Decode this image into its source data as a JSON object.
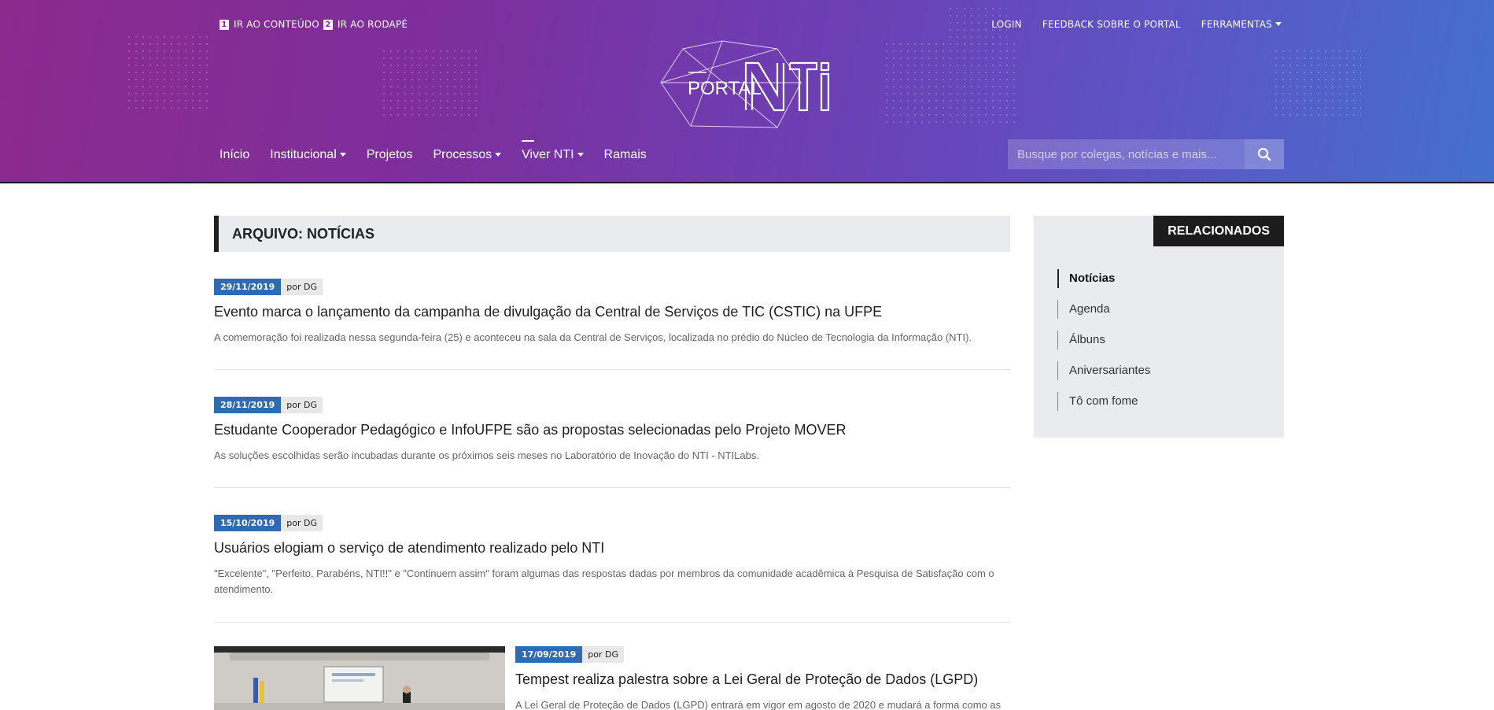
{
  "skip_links": [
    {
      "num": "1",
      "label": "IR AO CONTEÚDO"
    },
    {
      "num": "2",
      "label": "IR AO RODAPÉ"
    }
  ],
  "top_links": {
    "login": "LOGIN",
    "feedback": "FEEDBACK SOBRE O PORTAL",
    "tools": "FERRAMENTAS"
  },
  "logo": {
    "portal": "PORTAL",
    "brand": "NTI"
  },
  "nav": [
    {
      "label": "Início"
    },
    {
      "label": "Institucional"
    },
    {
      "label": "Projetos"
    },
    {
      "label": "Processos"
    },
    {
      "label": "Viver NTI"
    },
    {
      "label": "Ramais"
    }
  ],
  "search": {
    "placeholder": "Busque por colegas, notícias e mais..."
  },
  "archive_title": "ARQUIVO: NOTÍCIAS",
  "posts": [
    {
      "date": "29/11/2019",
      "author": "por DG",
      "title": "Evento marca o lançamento da campanha de divulgação da Central de Serviços de TIC (CSTIC) na UFPE",
      "excerpt": "A comemoração foi realizada nessa segunda-feira (25) e aconteceu na sala da Central de Serviços, localizada no prédio do Núcleo de Tecnologia da Informação (NTI)."
    },
    {
      "date": "28/11/2019",
      "author": "por DG",
      "title": "Estudante Cooperador Pedagógico e InfoUFPE são as propostas selecionadas pelo Projeto MOVER",
      "excerpt": "As soluções escolhidas serão incubadas durante os próximos seis meses no Laboratório de Inovação do NTI - NTILabs."
    },
    {
      "date": "15/10/2019",
      "author": "por DG",
      "title": "Usuários elogiam o serviço de atendimento realizado pelo NTI",
      "excerpt": "\"Excelente\", \"Perfeito. Parabéns, NTI!!\" e \"Continuem assim\" foram algumas das respostas dadas por membros da comunidade acadêmica à Pesquisa de Satisfação com o atendimento."
    },
    {
      "date": "17/09/2019",
      "author": "por DG",
      "title": "Tempest realiza palestra sobre a Lei Geral de Proteção de Dados (LGPD)",
      "excerpt": "A Lei Geral de Proteção de Dados (LGPD) entrará em vigor em agosto de 2020 e mudará a forma como as"
    }
  ],
  "sidebar": {
    "title": "RELACIONADOS",
    "items": [
      {
        "label": "Notícias"
      },
      {
        "label": "Agenda"
      },
      {
        "label": "Álbuns"
      },
      {
        "label": "Aniversariantes"
      },
      {
        "label": "Tô com fome"
      }
    ]
  },
  "colors": {
    "header_start": "#8c2a8e",
    "header_end": "#4470cf",
    "date_badge": "#2f6bb3",
    "sidebar_bg": "#e9ebee"
  }
}
